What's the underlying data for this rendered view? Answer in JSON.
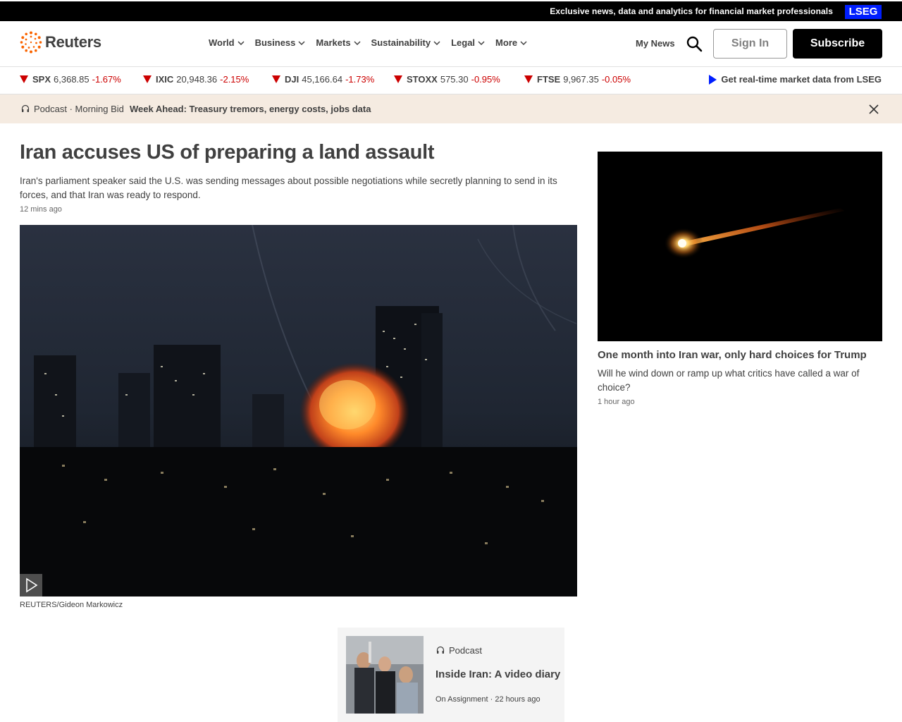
{
  "promo": {
    "text": "Exclusive news, data and analytics for financial market professionals",
    "badge": "LSEG"
  },
  "header": {
    "logo_text": "Reuters",
    "nav": [
      {
        "label": "World"
      },
      {
        "label": "Business"
      },
      {
        "label": "Markets"
      },
      {
        "label": "Sustainability"
      },
      {
        "label": "Legal"
      },
      {
        "label": "More"
      }
    ],
    "my_news": "My News",
    "sign_in": "Sign In",
    "subscribe": "Subscribe"
  },
  "ticker": {
    "items": [
      {
        "symbol": "SPX",
        "value": "6,368.85",
        "change": "-1.67%"
      },
      {
        "symbol": "IXIC",
        "value": "20,948.36",
        "change": "-2.15%"
      },
      {
        "symbol": "DJI",
        "value": "45,166.64",
        "change": "-1.73%"
      },
      {
        "symbol": "STOXX",
        "value": "575.30",
        "change": "-0.95%"
      },
      {
        "symbol": "FTSE",
        "value": "9,967.35",
        "change": "-0.05%"
      }
    ],
    "lseg_link": "Get real-time market data from LSEG"
  },
  "podcast_bar": {
    "label": "Podcast · Morning Bid",
    "title": "Week Ahead: Treasury tremors, energy costs, jobs data"
  },
  "main_story": {
    "headline": "Iran accuses US of preparing a land assault",
    "dek": "Iran's parliament speaker said the U.S. was sending messages about possible negotiations while secretly planning to send in its forces, and that Iran was ready to respond.",
    "time": "12 mins ago",
    "credit": "REUTERS/Gideon Markowicz"
  },
  "podcast_card": {
    "kind": "Podcast",
    "title": "Inside Iran: A video diary",
    "meta": "On Assignment · 22 hours ago"
  },
  "side_story": {
    "title": "One month into Iran war, only hard choices for Trump",
    "dek": "Will he wind down or ramp up what critics have called a war of choice?",
    "time": "1 hour ago"
  },
  "colors": {
    "accent_orange": "#fa6400",
    "down_red": "#cc0000",
    "lseg_blue": "#001eff",
    "pod_bg": "#f5ebe1"
  }
}
